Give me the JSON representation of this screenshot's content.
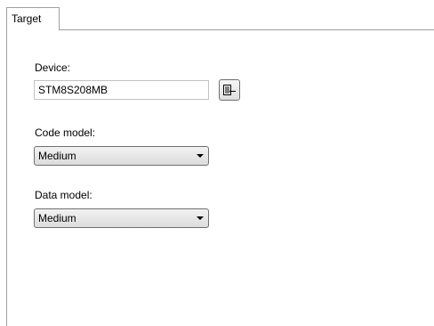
{
  "tabs": [
    {
      "label": "Target",
      "active": true
    }
  ],
  "device": {
    "label": "Device:",
    "value": "STM8S208MB",
    "browse_icon": "select-device-icon"
  },
  "code_model": {
    "label": "Code model:",
    "selected": "Medium"
  },
  "data_model": {
    "label": "Data model:",
    "selected": "Medium"
  },
  "colors": {
    "border": "#a0a0a0",
    "input_border": "#c2c2c2",
    "control_border": "#707070"
  }
}
